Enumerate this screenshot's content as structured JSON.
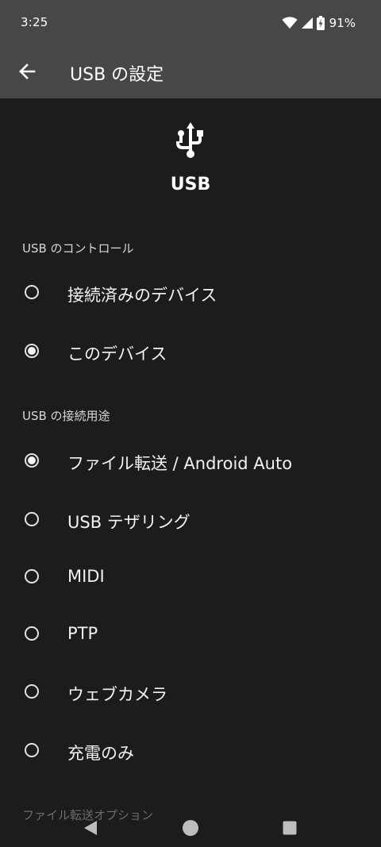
{
  "status_bar": {
    "time": "3:25",
    "battery": "91%",
    "icons": [
      "wifi-icon",
      "signal-icon",
      "battery-charging-icon"
    ]
  },
  "app_bar": {
    "back_icon": "arrow-back-icon",
    "title": "USB の設定"
  },
  "hero": {
    "icon": "usb-icon",
    "label": "USB"
  },
  "usb_control": {
    "header": "USB のコントロール",
    "options": [
      {
        "label": "接続済みのデバイス",
        "selected": false
      },
      {
        "label": "このデバイス",
        "selected": true
      }
    ]
  },
  "usb_purpose": {
    "header": "USB の接続用途",
    "options": [
      {
        "label": "ファイル転送 / Android Auto",
        "selected": true
      },
      {
        "label": "USB テザリング",
        "selected": false
      },
      {
        "label": "MIDI",
        "selected": false
      },
      {
        "label": "PTP",
        "selected": false
      },
      {
        "label": "ウェブカメラ",
        "selected": false
      },
      {
        "label": "充電のみ",
        "selected": false
      }
    ]
  },
  "file_transfer_options": {
    "header": "ファイル転送オプション"
  },
  "nav_bar": {
    "icons": [
      "back-triangle-icon",
      "home-circle-icon",
      "recents-square-icon"
    ]
  },
  "colors": {
    "background": "#1c1c1c",
    "app_bar": "#474747",
    "text": "#ffffff"
  }
}
